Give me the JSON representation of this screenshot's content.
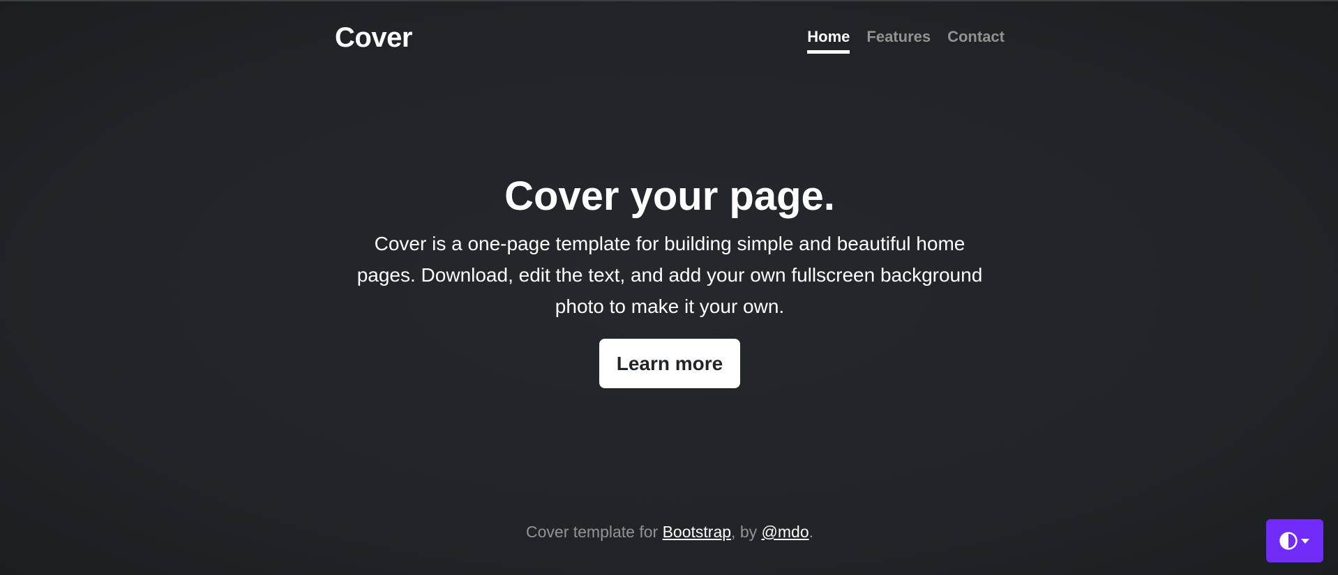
{
  "header": {
    "brand": "Cover",
    "nav": [
      {
        "label": "Home",
        "active": true
      },
      {
        "label": "Features",
        "active": false
      },
      {
        "label": "Contact",
        "active": false
      }
    ]
  },
  "main": {
    "title": "Cover your page.",
    "lead": "Cover is a one-page template for building simple and beautiful home pages. Download, edit the text, and add your own fullscreen background photo to make it your own.",
    "button_label": "Learn more"
  },
  "footer": {
    "prefix": "Cover template for ",
    "link1": "Bootstrap",
    "middle": ", by ",
    "link2": "@mdo",
    "suffix": "."
  },
  "theme_toggle": {
    "icon": "circle-half-icon",
    "caret_icon": "caret-down-icon",
    "color": "#712cf9"
  },
  "colors": {
    "background": "#212529",
    "text": "#ffffff",
    "muted": "rgba(255,255,255,0.5)"
  }
}
